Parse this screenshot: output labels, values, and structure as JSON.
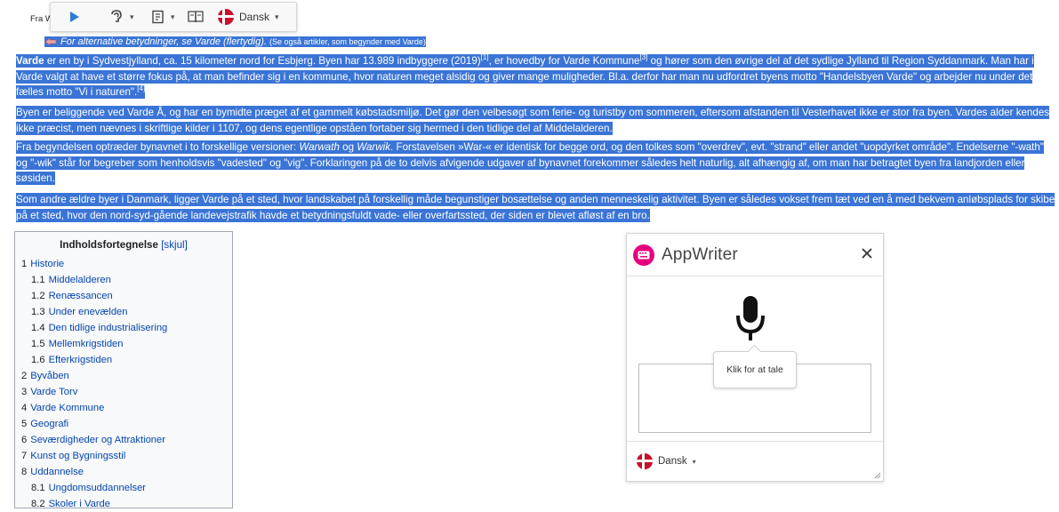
{
  "article": {
    "fra": "Fra Wikip",
    "hatnote": {
      "text": "For alternative betydninger, se Varde (flertydig).",
      "small": "(Se også artikler, som begynder med Varde)"
    },
    "p1": {
      "bold": "Varde",
      "a": " er en by i Sydvestjylland, ca. 15 kilometer nord for Esbjerg. Byen har 13.989 indbyggere (2019)",
      "ref1": "[1]",
      "b": ", er hovedby for Varde Kommune",
      "ref3": "[3]",
      "c": " og hører som den øvrige del af det sydlige Jylland til Region Syddanmark. Man har i Varde valgt at have et større fokus på, at man befinder sig i en kommune, hvor naturen meget alsidig og giver mange muligheder. Bl.a. derfor har man nu udfordret byens motto \"Handelsbyen Varde\" og arbejder nu under det fælles motto \"Vi i naturen\".",
      "ref4": "[4]"
    },
    "p2": "Byen er beliggende ved Varde Å, og har en bymidte præget af et gammelt købstadsmiljø. Det gør den velbesøgt som ferie- og turistby om sommeren, eftersom afstanden til Vesterhavet ikke er stor fra byen. Vardes alder kendes ikke præcist, men nævnes i skriftlige kilder i 1107, og dens egentlige opståen fortaber sig hermed i den tidlige del af Middelalderen.",
    "p3": {
      "a": "Fra begyndelsen optræder bynavnet i to forskellige versioner: ",
      "i1": "Warwath",
      "b": " og ",
      "i2": "Warwik",
      "c": ". Forstavelsen »War-« er identisk for begge ord, og den tolkes som \"overdrev\", evt. \"strand\" eller andet \"uopdyrket område\". Endelserne \"-wath\" og \"-wik\" står for begreber som henholdsvis \"vadested\" og \"vig\". Forklaringen på de to delvis afvigende udgaver af bynavnet forekommer således helt naturlig, alt afhængig af, om man har betragtet byen fra landjorden eller søsiden."
    },
    "p4": "Som andre ældre byer i Danmark, ligger Varde på et sted, hvor landskabet på forskellig måde begunstiger bosættelse og anden menneskelig aktivitet. Byen er således vokset frem tæt ved en å med bekvem anløbsplads for skibe på et sted, hvor den nord-syd-gående landevejstrafik havde et betydningsfuldt vade- eller overfartssted, der siden er blevet afløst af en bro."
  },
  "toolbar": {
    "play_icon": "play-icon",
    "speech_icon": "speech-icon",
    "reader_icon": "reader-icon",
    "book_icon": "book-icon",
    "language": "Dansk"
  },
  "toc": {
    "title": "Indholdsfortegnelse",
    "toggle": "[skjul]",
    "items": [
      {
        "num": "1",
        "label": "Historie",
        "level": 1
      },
      {
        "num": "1.1",
        "label": "Middelalderen",
        "level": 2
      },
      {
        "num": "1.2",
        "label": "Renæssancen",
        "level": 2
      },
      {
        "num": "1.3",
        "label": "Under enevælden",
        "level": 2
      },
      {
        "num": "1.4",
        "label": "Den tidlige industrialisering",
        "level": 2
      },
      {
        "num": "1.5",
        "label": "Mellemkrigstiden",
        "level": 2
      },
      {
        "num": "1.6",
        "label": "Efterkrigstiden",
        "level": 2
      },
      {
        "num": "2",
        "label": "Byvåben",
        "level": 1
      },
      {
        "num": "3",
        "label": "Varde Torv",
        "level": 1
      },
      {
        "num": "4",
        "label": "Varde Kommune",
        "level": 1
      },
      {
        "num": "5",
        "label": "Geografi",
        "level": 1
      },
      {
        "num": "6",
        "label": "Seværdigheder og Attraktioner",
        "level": 1
      },
      {
        "num": "7",
        "label": "Kunst og Bygningsstil",
        "level": 1
      },
      {
        "num": "8",
        "label": "Uddannelse",
        "level": 1
      },
      {
        "num": "8.1",
        "label": "Ungdomsuddannelser",
        "level": 2
      },
      {
        "num": "8.2",
        "label": "Skoler i Varde",
        "level": 2
      }
    ]
  },
  "appwriter": {
    "title": "AppWriter",
    "tooltip": "Klik for at tale",
    "language": "Dansk",
    "accent": "#e6007e"
  },
  "colors": {
    "selection": "#3a74d6",
    "link": "#0645ad"
  }
}
